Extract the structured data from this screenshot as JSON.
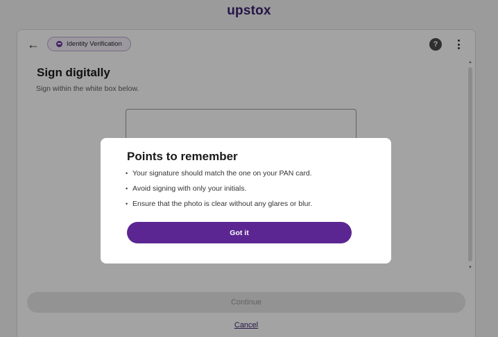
{
  "brand": {
    "logo_text": "upstox"
  },
  "topbar": {
    "back_icon": "arrow-left-icon",
    "step_pill_label": "Identity Verification",
    "help_icon_glyph": "?",
    "more_icon": "more-vertical-icon"
  },
  "page": {
    "heading": "Sign digitally",
    "subheading": "Sign within the white box below."
  },
  "actions": {
    "continue_label": "Continue",
    "cancel_label": "Cancel"
  },
  "modal": {
    "title": "Points to remember",
    "points": [
      "Your signature should match the one on your PAN card.",
      "Avoid signing with only your initials.",
      "Ensure that the photo is clear without any glares or blur."
    ],
    "button_label": "Got it"
  },
  "colors": {
    "brand_purple": "#5b2692",
    "logo_purple": "#3a2270",
    "overlay": "rgba(0,0,0,0.36)"
  }
}
